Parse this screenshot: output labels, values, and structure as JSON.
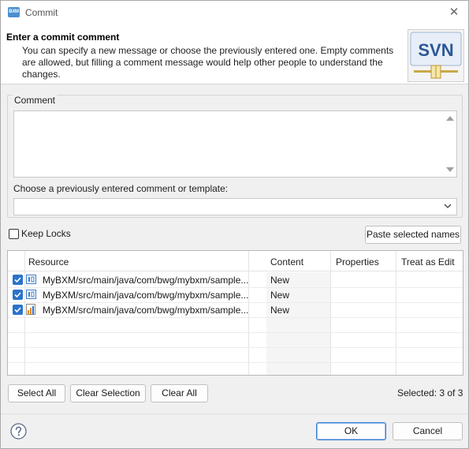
{
  "window": {
    "title": "Commit",
    "app_icon_text": "BXM"
  },
  "banner": {
    "title": "Enter a commit comment",
    "description": "You can specify a new message or choose the previously entered one. Empty comments are allowed, but filling a comment message would help other people to understand the changes.",
    "logo_text": "SVN"
  },
  "comment": {
    "group_label": "Comment",
    "value": "",
    "template_label": "Choose a previously entered comment or template:",
    "template_value": ""
  },
  "keep_locks": {
    "label": "Keep Locks",
    "checked": false
  },
  "paste_button": "Paste selected names",
  "table": {
    "columns": [
      "Resource",
      "Content",
      "Properties",
      "Treat as Edit"
    ],
    "rows": [
      {
        "checked": true,
        "icon": "java-file-icon",
        "resource": "MyBXM/src/main/java/com/bwg/mybxm/sample...",
        "content": "New",
        "properties": "",
        "treat_as_edit": ""
      },
      {
        "checked": true,
        "icon": "java-file-icon",
        "resource": "MyBXM/src/main/java/com/bwg/mybxm/sample...",
        "content": "New",
        "properties": "",
        "treat_as_edit": ""
      },
      {
        "checked": true,
        "icon": "chart-file-icon",
        "resource": "MyBXM/src/main/java/com/bwg/mybxm/sample...",
        "content": "New",
        "properties": "",
        "treat_as_edit": ""
      }
    ]
  },
  "buttons": {
    "select_all": "Select All",
    "clear_selection": "Clear Selection",
    "clear_all": "Clear All",
    "ok": "OK",
    "cancel": "Cancel"
  },
  "selected_count": "Selected: 3 of 3",
  "colors": {
    "accent": "#2b73c9",
    "logo_blue": "#2b5797",
    "logo_bg": "#e8eef7"
  }
}
